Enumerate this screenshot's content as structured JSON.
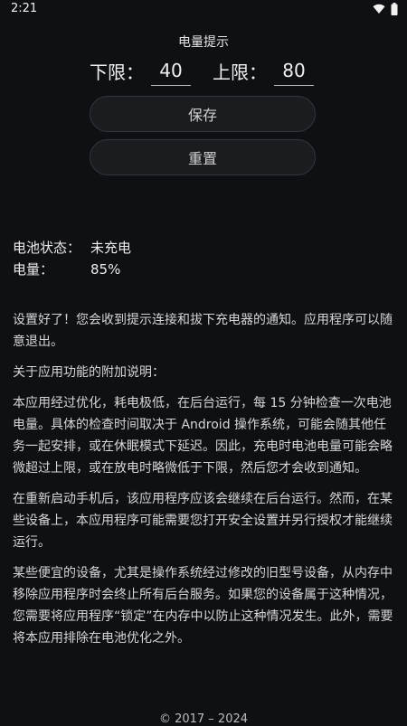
{
  "status_bar": {
    "time": "2:21",
    "wifi_icon": "wifi-icon",
    "battery_icon": "battery-icon"
  },
  "title": "电量提示",
  "limits": {
    "lower_label": "下限：",
    "lower_value": "40",
    "upper_label": "上限：",
    "upper_value": "80"
  },
  "buttons": {
    "save": "保存",
    "reset": "重置"
  },
  "battery": {
    "state_label": "电池状态：",
    "state_value": "未充电",
    "level_label": "电量：",
    "level_value": "85%"
  },
  "description": [
    "设置好了！您会收到提示连接和拔下充电器的通知。应用程序可以随意退出。",
    "关于应用功能的附加说明：",
    "本应用经过优化，耗电极低，在后台运行，每 15 分钟检查一次电池电量。具体的检查时间取决于 Android 操作系统，可能会随其他任务一起安排，或在休眠模式下延迟。因此，充电时电池电量可能会略微超过上限，或在放电时略微低于下限，然后您才会收到通知。",
    "在重新启动手机后，该应用程序应该会继续在后台运行。然而，在某些设备上，本应用程序可能需要您打开安全设置并另行授权才能继续运行。",
    "某些便宜的设备，尤其是操作系统经过修改的旧型号设备，从内存中移除应用程序时会终止所有后台服务。如果您的设备属于这种情况，您需要将应用程序“锁定”在内存中以防止这种情况发生。此外，需要将本应用排除在电池优化之外。"
  ],
  "footer": "© 2017 – 2024"
}
